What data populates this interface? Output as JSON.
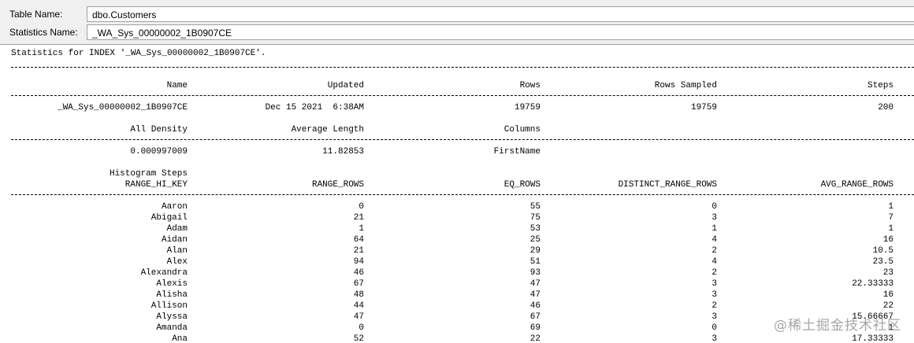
{
  "fields": {
    "table_name_label": "Table Name:",
    "table_name_value": "dbo.Customers",
    "statistics_name_label": "Statistics Name:",
    "statistics_name_value": "_WA_Sys_00000002_1B0907CE"
  },
  "output": {
    "title": "Statistics for INDEX '_WA_Sys_00000002_1B0907CE'.",
    "header1": {
      "columns": [
        "Name",
        "Updated",
        "Rows",
        "Rows Sampled",
        "Steps"
      ],
      "row": [
        "_WA_Sys_00000002_1B0907CE",
        "Dec 15 2021  6:38AM",
        "19759",
        "19759",
        "200"
      ]
    },
    "header2": {
      "columns": [
        "All Density",
        "Average Length",
        "Columns"
      ],
      "row": [
        "0.000997009",
        "11.82853",
        "FirstName"
      ]
    },
    "histogram": {
      "caption": "Histogram Steps",
      "columns": [
        "RANGE_HI_KEY",
        "RANGE_ROWS",
        "EQ_ROWS",
        "DISTINCT_RANGE_ROWS",
        "AVG_RANGE_ROWS"
      ],
      "rows": [
        [
          "Aaron",
          "0",
          "55",
          "0",
          "1"
        ],
        [
          "Abigail",
          "21",
          "75",
          "3",
          "7"
        ],
        [
          "Adam",
          "1",
          "53",
          "1",
          "1"
        ],
        [
          "Aidan",
          "64",
          "25",
          "4",
          "16"
        ],
        [
          "Alan",
          "21",
          "29",
          "2",
          "10.5"
        ],
        [
          "Alex",
          "94",
          "51",
          "4",
          "23.5"
        ],
        [
          "Alexandra",
          "46",
          "93",
          "2",
          "23"
        ],
        [
          "Alexis",
          "67",
          "47",
          "3",
          "22.33333"
        ],
        [
          "Alisha",
          "48",
          "47",
          "3",
          "16"
        ],
        [
          "Allison",
          "44",
          "46",
          "2",
          "22"
        ],
        [
          "Alyssa",
          "47",
          "67",
          "3",
          "15.66667"
        ],
        [
          "Amanda",
          "0",
          "69",
          "0",
          "1"
        ],
        [
          "Ana",
          "52",
          "22",
          "3",
          "17.33333"
        ]
      ]
    }
  },
  "watermark": "@稀土掘金技术社区"
}
